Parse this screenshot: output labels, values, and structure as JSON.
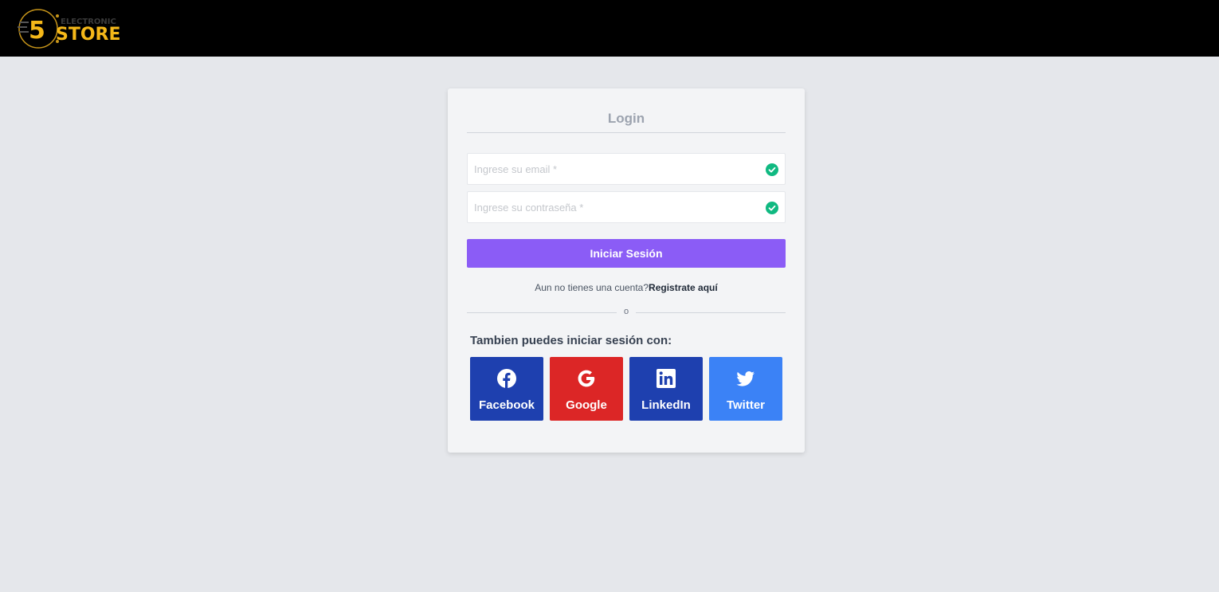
{
  "header": {
    "logo_top": "ELECTRONIC",
    "logo_main": "STORE",
    "logo_digit": "5"
  },
  "login": {
    "title": "Login",
    "email_placeholder": "Ingrese su email *",
    "password_placeholder": "Ingrese su contraseña *",
    "submit_label": "Iniciar Sesión",
    "register_prompt": "Aun no tienes una cuenta?",
    "register_link": "Registrate aquí",
    "divider_text": "o",
    "alt_title": "Tambien puedes iniciar sesión con:"
  },
  "social": [
    {
      "label": "Facebook",
      "icon": "facebook-icon",
      "color": "#1e40af"
    },
    {
      "label": "Google",
      "icon": "google-icon",
      "color": "#dc2626"
    },
    {
      "label": "LinkedIn",
      "icon": "linkedin-icon",
      "color": "#1e40af"
    },
    {
      "label": "Twitter",
      "icon": "twitter-icon",
      "color": "#3b82f6"
    }
  ],
  "colors": {
    "header_bg": "#000000",
    "page_bg": "#e5e7eb",
    "card_bg": "#f3f4f6",
    "primary": "#8b5cf6",
    "valid": "#10b981",
    "logo_gold": "#f5b819"
  }
}
